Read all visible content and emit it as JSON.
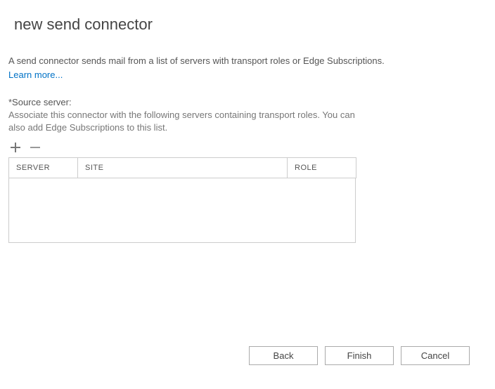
{
  "header": {
    "title": "new send connector"
  },
  "intro": {
    "text": "A send connector sends mail from a list of servers with transport roles or Edge Subscriptions.",
    "learn_more": "Learn more..."
  },
  "source": {
    "label": "*Source server:",
    "help": "Associate this connector with the following servers containing transport roles. You can also add Edge Subscriptions to this list."
  },
  "grid": {
    "columns": {
      "server": "SERVER",
      "site": "SITE",
      "role": "ROLE"
    },
    "rows": []
  },
  "buttons": {
    "back": "Back",
    "finish": "Finish",
    "cancel": "Cancel"
  }
}
